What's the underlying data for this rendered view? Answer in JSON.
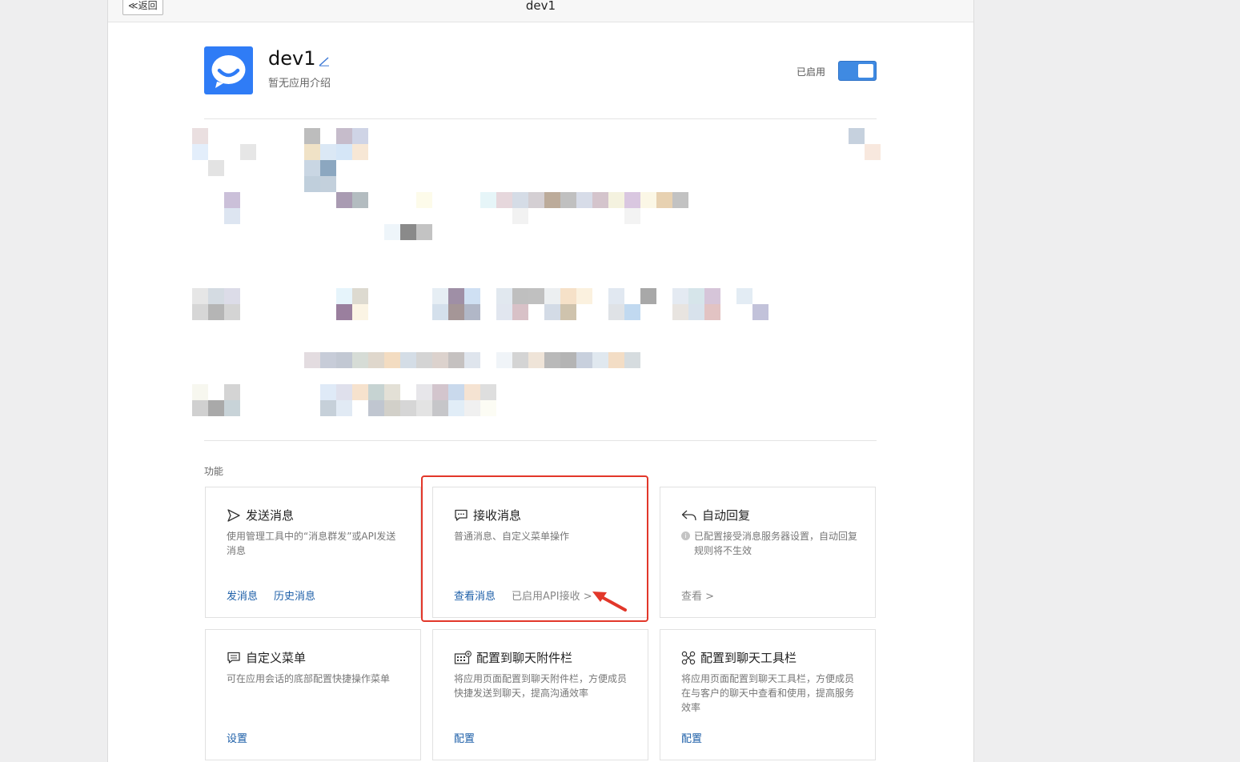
{
  "header": {
    "back_label": "≪返回",
    "title": "dev1"
  },
  "app": {
    "name": "dev1",
    "description": "暂无应用介绍",
    "status_label": "已启用",
    "enabled": true,
    "logo_color": "#2f7cf6"
  },
  "features": {
    "section_label": "功能",
    "cards": [
      {
        "title": "发送消息",
        "icon": "send-icon",
        "desc": "使用管理工具中的“消息群发”或API发送消息",
        "actions": [
          "发消息",
          "历史消息"
        ]
      },
      {
        "title": "接收消息",
        "icon": "chat-bubble-icon",
        "desc": "普通消息、自定义菜单操作",
        "actions": [
          "查看消息",
          "已启用API接收 >"
        ]
      },
      {
        "title": "自动回复",
        "icon": "reply-icon",
        "desc": "已配置接受消息服务器设置，自动回复规则将不生效",
        "actions": [
          "查看 >"
        ]
      },
      {
        "title": "自定义菜单",
        "icon": "menu-icon",
        "desc": "可在应用会话的底部配置快捷操作菜单",
        "actions": [
          "设置"
        ]
      },
      {
        "title": "配置到聊天附件栏",
        "icon": "attachment-bar-icon",
        "desc": "将应用页面配置到聊天附件栏，方便成员快捷发送到聊天，提高沟通效率",
        "actions": [
          "配置"
        ]
      },
      {
        "title": "配置到聊天工具栏",
        "icon": "toolbar-icon",
        "desc": "将应用页面配置到聊天工具栏，方便成员在与客户的聊天中查看和使用，提高服务效率",
        "actions": [
          "配置"
        ]
      }
    ]
  },
  "colors": {
    "accent": "#3f8ae2",
    "link": "#1d5fa8",
    "annotation": "#e2372a"
  }
}
